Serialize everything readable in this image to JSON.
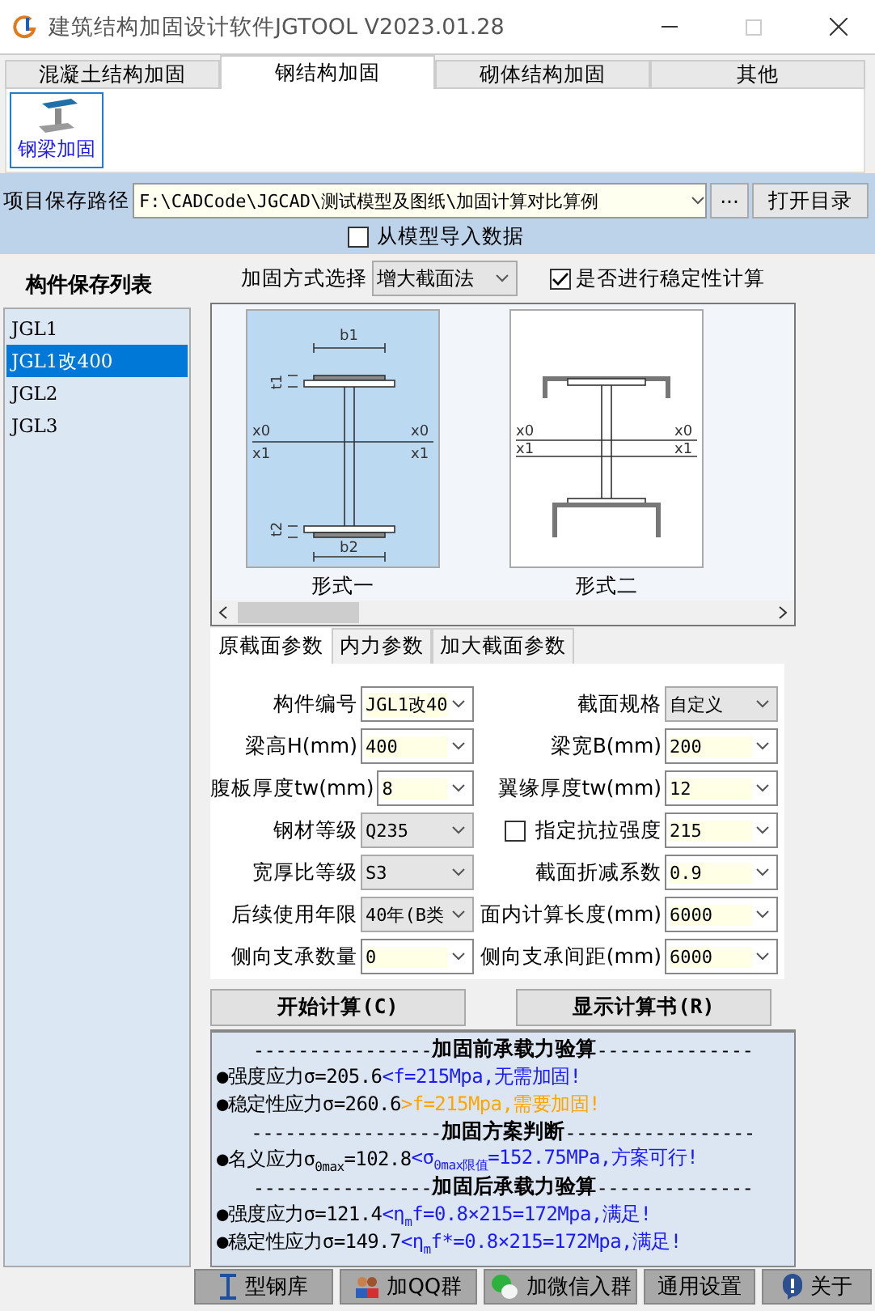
{
  "window": {
    "title": "建筑结构加固设计软件JGTOOL V2023.01.28"
  },
  "tabs": [
    {
      "label": "混凝土结构加固",
      "selected": false
    },
    {
      "label": "钢结构加固",
      "selected": true
    },
    {
      "label": "砌体结构加固",
      "selected": false
    },
    {
      "label": "其他",
      "selected": false
    }
  ],
  "ribbon": [
    {
      "label": "钢梁加固",
      "selected": true
    }
  ],
  "path": {
    "label": "项目保存路径",
    "value": "F:\\CADCode\\JGCAD\\测试模型及图纸\\加固计算对比算例",
    "browse": "···",
    "open_button": "打开目录"
  },
  "import_checkbox": {
    "label": "从模型导入数据",
    "checked": false
  },
  "member_list": {
    "title": "构件保存列表",
    "items": [
      {
        "label": "JGL1",
        "selected": false
      },
      {
        "label": "JGL1改400",
        "selected": true
      },
      {
        "label": "JGL2",
        "selected": false
      },
      {
        "label": "JGL3",
        "selected": false
      }
    ]
  },
  "method": {
    "label": "加固方式选择",
    "value": "增大截面法"
  },
  "stability_checkbox": {
    "label": "是否进行稳定性计算",
    "checked": true
  },
  "forms": [
    {
      "label": "形式一",
      "kind": "plates",
      "selected": true,
      "marks": [
        "b1",
        "t1",
        "x0",
        "x0",
        "x1",
        "x1",
        "t2",
        "b2"
      ]
    },
    {
      "label": "形式二",
      "kind": "channels",
      "selected": false,
      "marks": [
        "x0",
        "x0",
        "x1",
        "x1"
      ]
    }
  ],
  "param_tabs": [
    {
      "label": "原截面参数",
      "selected": true
    },
    {
      "label": "内力参数",
      "selected": false
    },
    {
      "label": "加大截面参数",
      "selected": false
    }
  ],
  "params": [
    {
      "label": "构件编号",
      "value": "JGL1改40",
      "editable": true
    },
    {
      "label": "截面规格",
      "value": "自定义",
      "editable": false
    },
    {
      "label": "梁高H(mm)",
      "value": "400",
      "editable": true
    },
    {
      "label": "梁宽B(mm)",
      "value": "200",
      "editable": true
    },
    {
      "label": "腹板厚度tw(mm)",
      "value": "8",
      "editable": true
    },
    {
      "label": "翼缘厚度tw(mm)",
      "value": "12",
      "editable": true
    },
    {
      "label": "钢材等级",
      "value": "Q235",
      "editable": false
    },
    {
      "label": "指定抗拉强度",
      "value": "215",
      "editable": true,
      "checked": false
    },
    {
      "label": "宽厚比等级",
      "value": "S3",
      "editable": false
    },
    {
      "label": "截面折减系数",
      "value": "0.9",
      "editable": true
    },
    {
      "label": "后续使用年限",
      "value": "40年(B类",
      "editable": false
    },
    {
      "label": "面内计算长度(mm)",
      "value": "6000",
      "editable": true
    },
    {
      "label": "侧向支承数量",
      "value": "0",
      "editable": true
    },
    {
      "label": "侧向支承间距(mm)",
      "value": "6000",
      "editable": true
    }
  ],
  "actions": [
    "开始计算(C)",
    "显示计算书(R)"
  ],
  "results": [
    {
      "kind": "heading",
      "left": "----------------",
      "title": "加固前承载力验算",
      "right": "--------------"
    },
    {
      "kind": "line",
      "segments": [
        {
          "text": "●强度应力σ=205.6",
          "color": "#000000"
        },
        {
          "text": "<f=215Mpa,无需加固!",
          "color": "#1a1aff"
        }
      ]
    },
    {
      "kind": "line",
      "segments": [
        {
          "text": "●稳定性应力σ=260.6",
          "color": "#000000"
        },
        {
          "text": ">f=215Mpa,需要加固!",
          "color": "#ffa500"
        }
      ]
    },
    {
      "kind": "heading",
      "left": "-----------------",
      "title": "加固方案判断",
      "right": "-----------------"
    },
    {
      "kind": "line",
      "segments": [
        {
          "text": "●名义应力σ$_{0max}$=102.8",
          "color": "#000000"
        },
        {
          "text": "<σ$_{0max限值}$=152.75MPa,方案可行!",
          "color": "#1a1aff"
        }
      ]
    },
    {
      "kind": "heading",
      "left": "----------------",
      "title": "加固后承载力验算",
      "right": "--------------"
    },
    {
      "kind": "line",
      "segments": [
        {
          "text": "●强度应力σ=121.4",
          "color": "#000000"
        },
        {
          "text": "<η$_{m}$f=0.8×215=172Mpa,满足!",
          "color": "#1a1aff"
        }
      ]
    },
    {
      "kind": "line",
      "segments": [
        {
          "text": "●稳定性应力σ=149.7",
          "color": "#000000"
        },
        {
          "text": "<η$_{m}$f*=0.8×215=172Mpa,满足!",
          "color": "#1a1aff"
        }
      ]
    }
  ],
  "bottom_buttons": [
    "型钢库",
    "加QQ群",
    "加微信入群",
    "通用设置",
    "关于"
  ]
}
